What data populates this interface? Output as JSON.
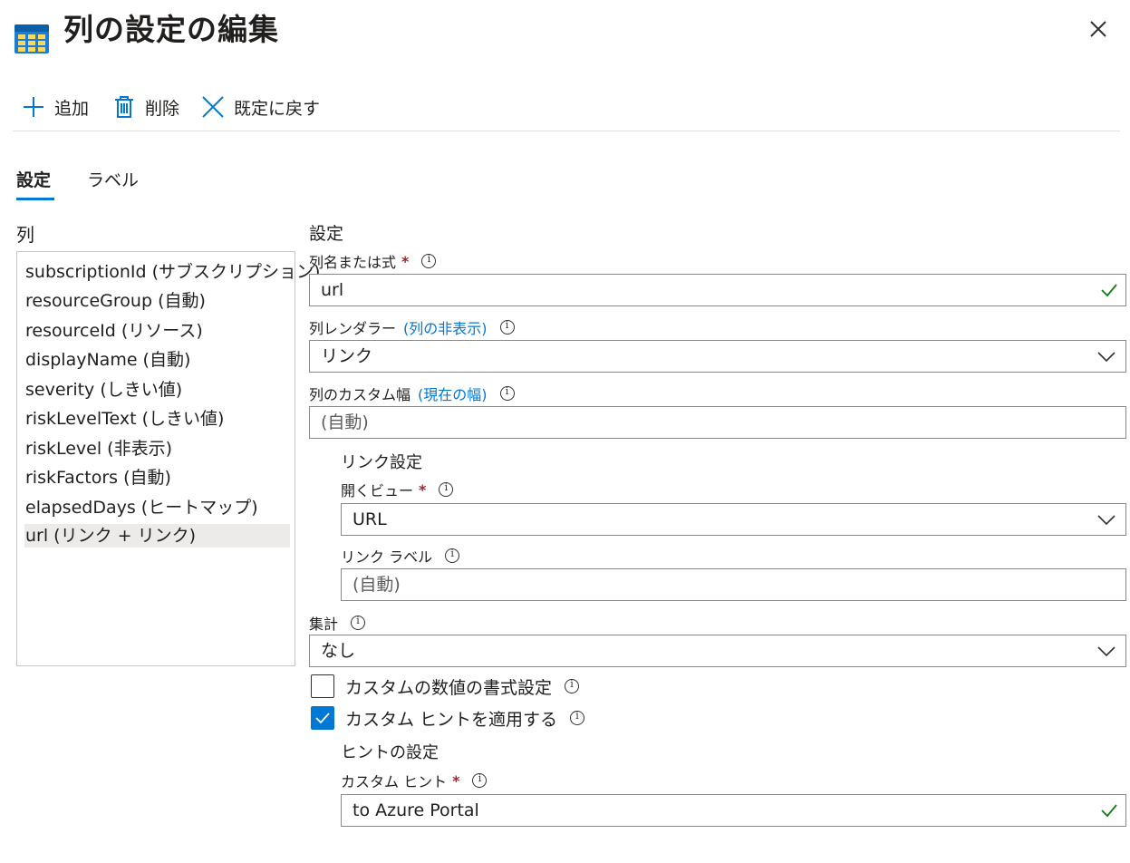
{
  "header": {
    "title": "列の設定の編集",
    "icon": "grid-table-icon",
    "close_icon": "close-icon"
  },
  "toolbar": {
    "add_label": "追加",
    "delete_label": "削除",
    "reset_label": "既定に戻す"
  },
  "tabs": [
    {
      "label": "設定",
      "active": true
    },
    {
      "label": "ラベル",
      "active": false
    }
  ],
  "columns": {
    "heading": "列",
    "items": [
      "subscriptionId (サブスクリプション)",
      "resourceGroup (自動)",
      "resourceId (リソース)",
      "displayName (自動)",
      "severity (しきい値)",
      "riskLevelText (しきい値)",
      "riskLevel (非表示)",
      "riskFactors (自動)",
      "elapsedDays (ヒートマップ)",
      "url (リンク + リンク)"
    ],
    "selected_index": 9
  },
  "settings": {
    "heading": "設定",
    "column_name": {
      "label": "列名または式",
      "required_mark": "*",
      "value": "url"
    },
    "renderer": {
      "label": "列レンダラー",
      "link": "(列の非表示)",
      "value": "リンク"
    },
    "custom_width": {
      "label": "列のカスタム幅",
      "link": "(現在の幅)",
      "placeholder": "(自動)"
    },
    "link_settings": {
      "heading": "リンク設定",
      "open_view": {
        "label": "開くビュー",
        "required_mark": "*",
        "value": "URL"
      },
      "link_label": {
        "label": "リンク ラベル",
        "placeholder": "(自動)"
      }
    },
    "aggregation": {
      "label": "集計",
      "value": "なし"
    },
    "custom_number_format": {
      "label": "カスタムの数値の書式設定",
      "checked": false
    },
    "custom_hint": {
      "label": "カスタム ヒントを適用する",
      "checked": true
    },
    "hint_settings": {
      "heading": "ヒントの設定",
      "hint": {
        "label": "カスタム ヒント",
        "required_mark": "*",
        "value": "to Azure Portal"
      }
    }
  },
  "colors": {
    "accent": "#0078d4",
    "valid_check": "#107c10",
    "required": "#a4262c",
    "selected_row": "#edebe9"
  }
}
